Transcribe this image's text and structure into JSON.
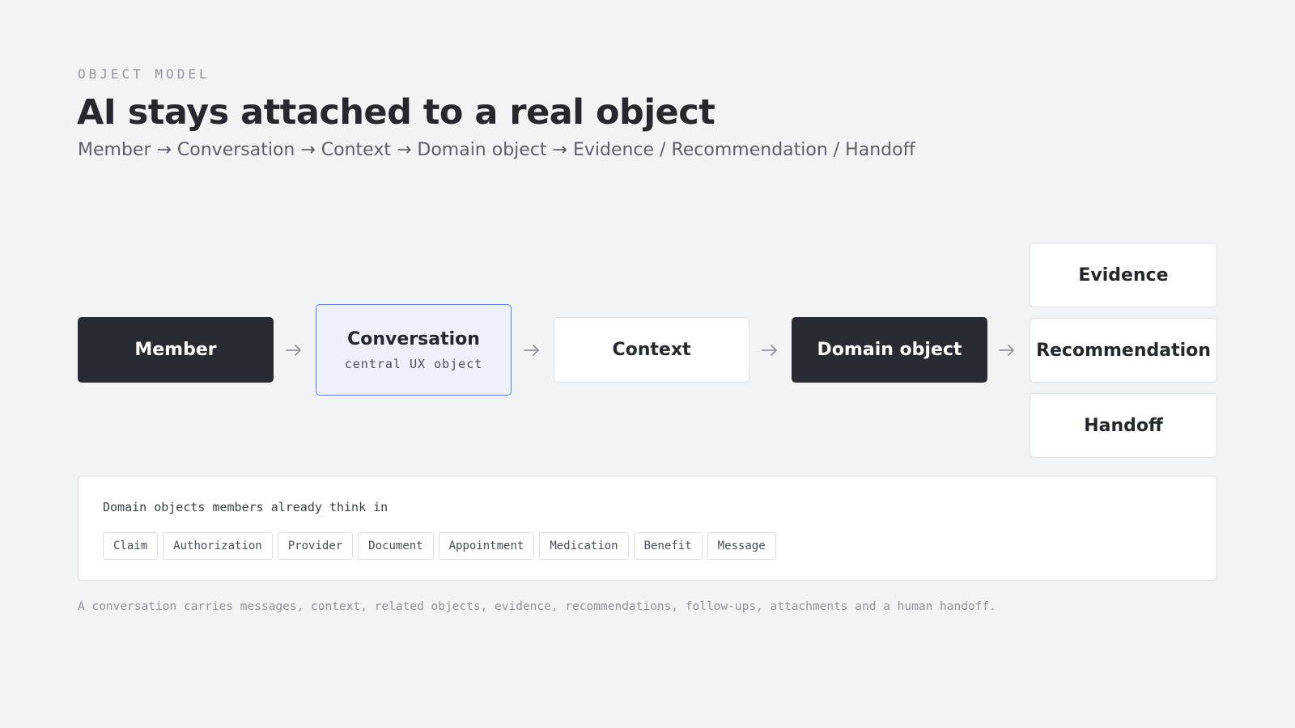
{
  "header": {
    "eyebrow": "OBJECT MODEL",
    "title": "AI stays attached to a real object",
    "subtitle": "Member → Conversation → Context → Domain object → Evidence / Recommendation / Handoff"
  },
  "flow": {
    "member": {
      "label": "Member"
    },
    "conversation": {
      "label": "Conversation",
      "sublabel": "central UX object"
    },
    "context": {
      "label": "Context"
    },
    "domain_object": {
      "label": "Domain object"
    },
    "outputs": [
      {
        "label": "Evidence"
      },
      {
        "label": "Recommendation"
      },
      {
        "label": "Handoff"
      }
    ]
  },
  "domain_panel": {
    "title": "Domain objects members already think in",
    "chips": [
      "Claim",
      "Authorization",
      "Provider",
      "Document",
      "Appointment",
      "Medication",
      "Benefit",
      "Message"
    ]
  },
  "footnote": "A conversation carries messages, context, related objects, evidence, recommendations, follow-ups, attachments and a human handoff.",
  "colors": {
    "background": "#f2f3f5",
    "dark_node": "#282b31",
    "accent_border": "#5a7fe0",
    "accent_fill": "#edf1fb",
    "muted_text": "#8f949c"
  }
}
